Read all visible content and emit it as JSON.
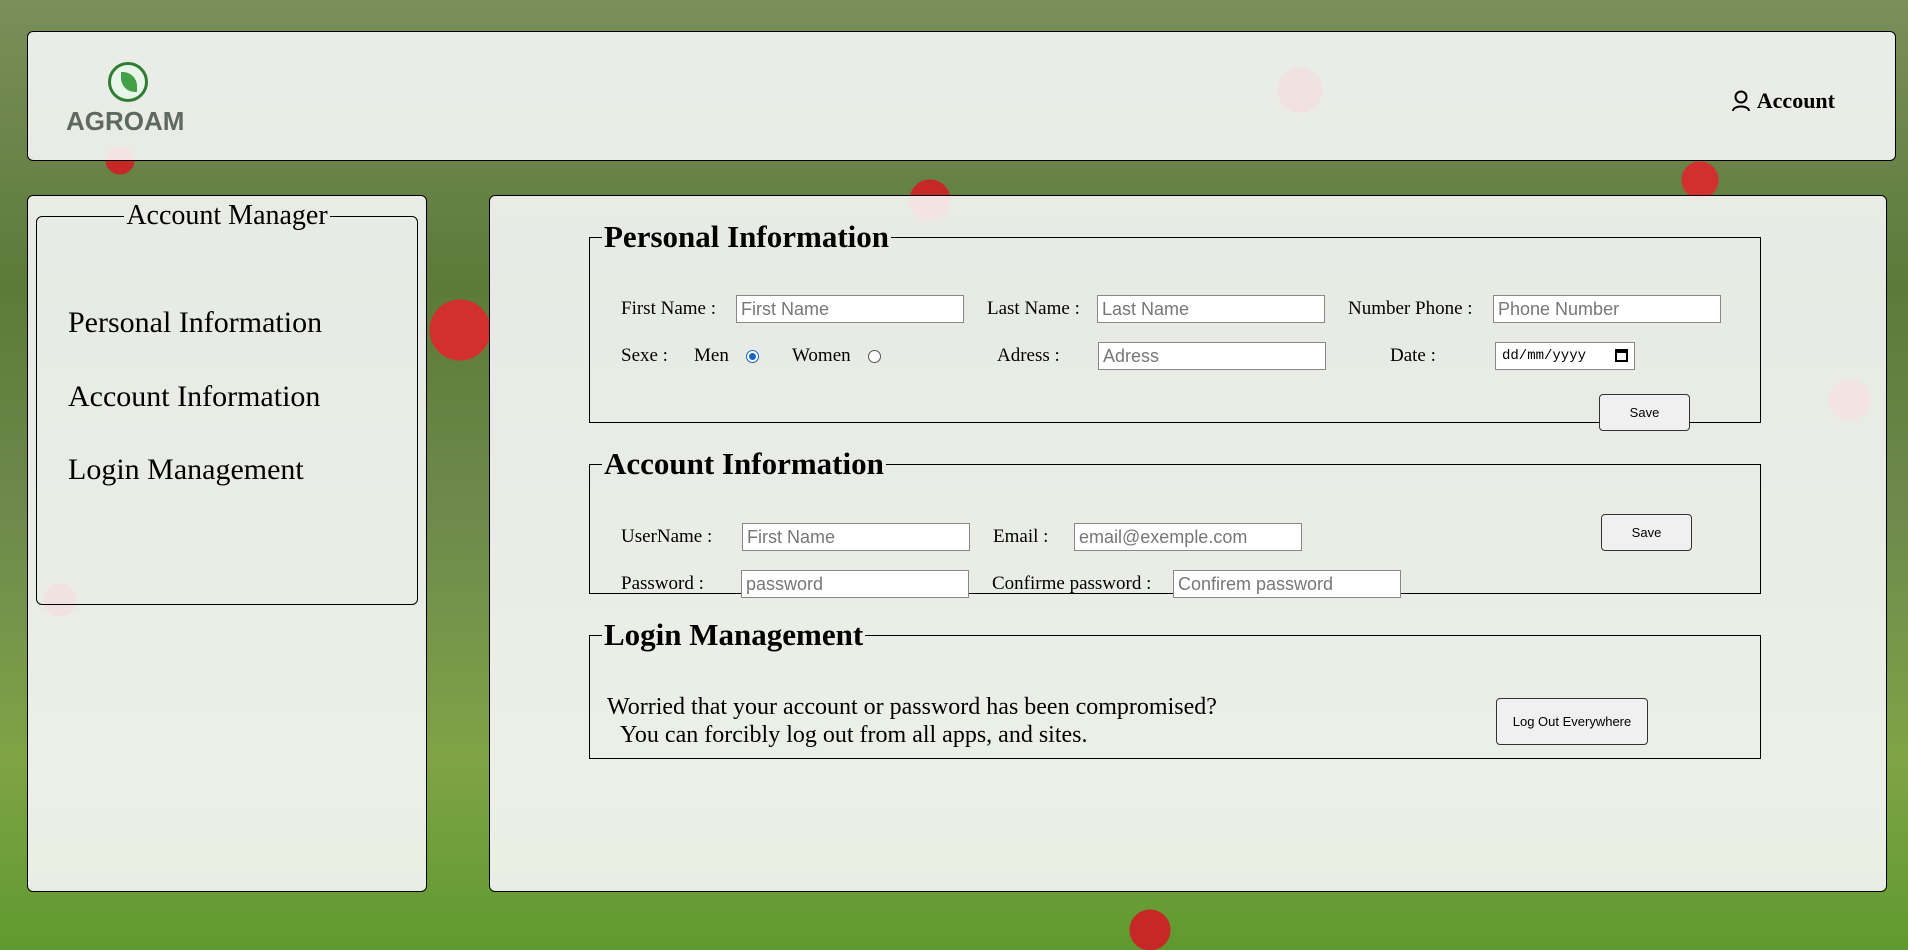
{
  "header": {
    "logo_text": "AGROAM",
    "account_label": "Account"
  },
  "sidebar": {
    "title": "Account Manager",
    "items": [
      {
        "label": "Personal Information"
      },
      {
        "label": "Account Information"
      },
      {
        "label": "Login Management"
      }
    ]
  },
  "personal": {
    "title": "Personal Information",
    "first_name_label": "First Name :",
    "first_name_placeholder": "First Name",
    "last_name_label": "Last Name :",
    "last_name_placeholder": "Last Name",
    "phone_label": "Number Phone :",
    "phone_placeholder": "Phone Number",
    "sex_label": "Sexe :",
    "sex_men": "Men",
    "sex_women": "Women",
    "sex_selected": "Men",
    "address_label": "Adress :",
    "address_placeholder": "Adress",
    "date_label": "Date :",
    "date_placeholder": "dd/mm/yyyy",
    "save_label": "Save"
  },
  "account": {
    "title": "Account Information",
    "username_label": "UserName :",
    "username_placeholder": "First Name",
    "email_label": "Email :",
    "email_placeholder": "email@exemple.com",
    "password_label": "Password :",
    "password_placeholder": "password",
    "confirm_label": "Confirme password :",
    "confirm_placeholder": "Confirem password",
    "save_label": "Save"
  },
  "login": {
    "title": "Login Management",
    "line1": "Worried that your account or password has been compromised?",
    "line2": "You can forcibly log out from all apps, and sites.",
    "logout_label": "Log Out Everywhere"
  }
}
